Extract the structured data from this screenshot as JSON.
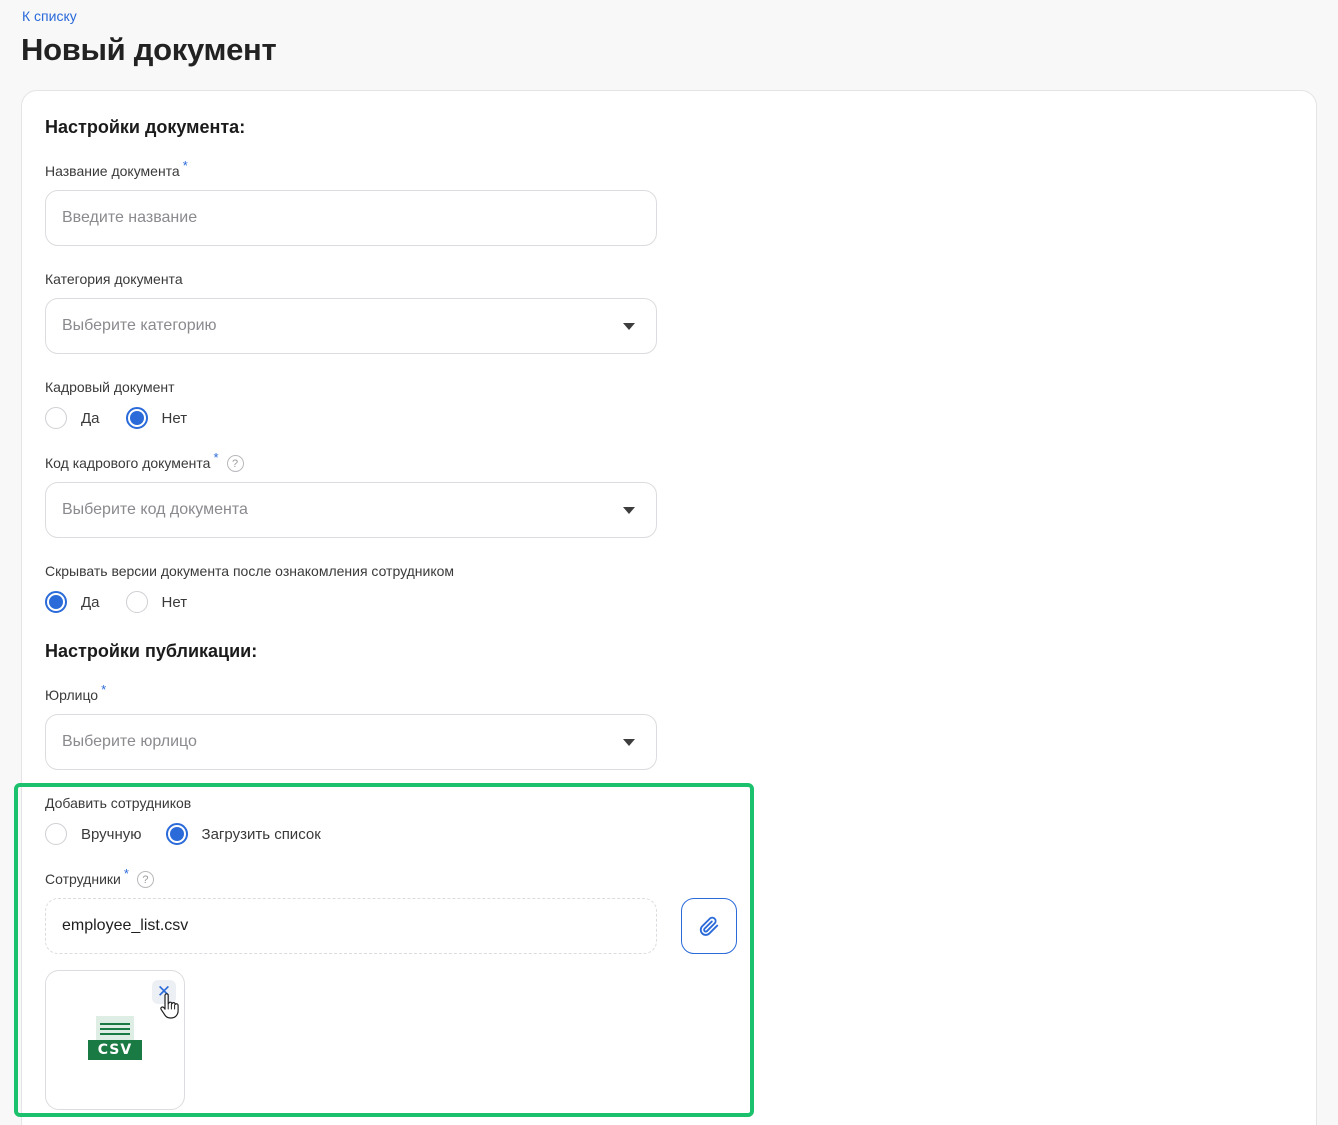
{
  "nav": {
    "back_label": "К списку"
  },
  "page": {
    "title": "Новый документ"
  },
  "doc_settings": {
    "heading": "Настройки документа:",
    "name": {
      "label": "Название документа",
      "required": "*",
      "placeholder": "Введите название",
      "value": ""
    },
    "category": {
      "label": "Категория документа",
      "placeholder": "Выберите категорию"
    },
    "hr_doc": {
      "label": "Кадровый документ",
      "options": [
        "Да",
        "Нет"
      ],
      "selected": "Нет"
    },
    "hr_code": {
      "label": "Код кадрового документа",
      "required": "*",
      "help": "?",
      "placeholder": "Выберите код документа"
    },
    "hide_versions": {
      "label": "Скрывать версии документа после ознакомления сотрудником",
      "options": [
        "Да",
        "Нет"
      ],
      "selected": "Да"
    }
  },
  "pub_settings": {
    "heading": "Настройки публикации:",
    "entity": {
      "label": "Юрлицо",
      "required": "*",
      "placeholder": "Выберите юрлицо"
    },
    "add_employees": {
      "label": "Добавить сотрудников",
      "options": [
        "Вручную",
        "Загрузить список"
      ],
      "selected": "Загрузить список"
    },
    "employees": {
      "label": "Сотрудники",
      "required": "*",
      "help": "?",
      "file_name": "employee_list.csv",
      "file_badge": "CSV",
      "remove_glyph": "✕"
    }
  },
  "colors": {
    "accent": "#2a6ad9",
    "highlight": "#1cc16d",
    "csv_green": "#1a7a43"
  },
  "icons": [
    "help-icon",
    "chevron-down-icon",
    "paperclip-icon",
    "csv-file-icon",
    "close-icon",
    "hand-cursor-icon"
  ]
}
